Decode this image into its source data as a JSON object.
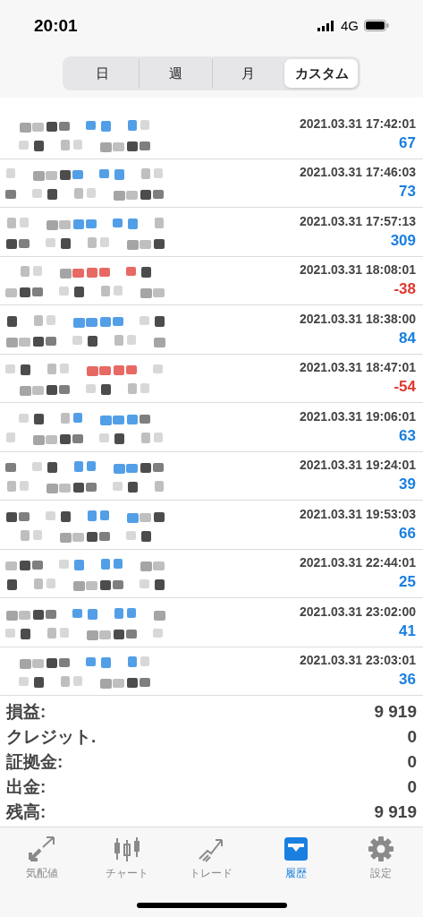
{
  "status_bar": {
    "time": "20:01",
    "network": "4G"
  },
  "segments": [
    {
      "label": "日",
      "selected": false
    },
    {
      "label": "週",
      "selected": false
    },
    {
      "label": "月",
      "selected": false
    },
    {
      "label": "カスタム",
      "selected": true
    }
  ],
  "deals": [
    {
      "time": "2021.03.31 17:42:01",
      "profit": "67",
      "color": "#1a7fe0"
    },
    {
      "time": "2021.03.31 17:46:03",
      "profit": "73",
      "color": "#1a7fe0"
    },
    {
      "time": "2021.03.31 17:57:13",
      "profit": "309",
      "color": "#1a7fe0"
    },
    {
      "time": "2021.03.31 18:08:01",
      "profit": "-38",
      "color": "#e0382f"
    },
    {
      "time": "2021.03.31 18:38:00",
      "profit": "84",
      "color": "#1a7fe0"
    },
    {
      "time": "2021.03.31 18:47:01",
      "profit": "-54",
      "color": "#e0382f"
    },
    {
      "time": "2021.03.31 19:06:01",
      "profit": "63",
      "color": "#1a7fe0"
    },
    {
      "time": "2021.03.31 19:24:01",
      "profit": "39",
      "color": "#1a7fe0"
    },
    {
      "time": "2021.03.31 19:53:03",
      "profit": "66",
      "color": "#1a7fe0"
    },
    {
      "time": "2021.03.31 22:44:01",
      "profit": "25",
      "color": "#1a7fe0"
    },
    {
      "time": "2021.03.31 23:02:00",
      "profit": "41",
      "color": "#1a7fe0"
    },
    {
      "time": "2021.03.31 23:03:01",
      "profit": "36",
      "color": "#1a7fe0"
    }
  ],
  "summary": [
    {
      "label": "損益:",
      "value": "9 919"
    },
    {
      "label": "クレジット.",
      "value": "0"
    },
    {
      "label": "証拠金:",
      "value": "0"
    },
    {
      "label": "出金:",
      "value": "0"
    },
    {
      "label": "残高:",
      "value": "9 919"
    }
  ],
  "tab_bar": [
    {
      "label": "気配値",
      "kind": "arrows",
      "selected": false
    },
    {
      "label": "チャート",
      "kind": "candles",
      "selected": false
    },
    {
      "label": "トレード",
      "kind": "trend",
      "selected": false
    },
    {
      "label": "履歴",
      "kind": "inbox",
      "selected": true
    },
    {
      "label": "設定",
      "kind": "gear",
      "selected": false
    }
  ]
}
